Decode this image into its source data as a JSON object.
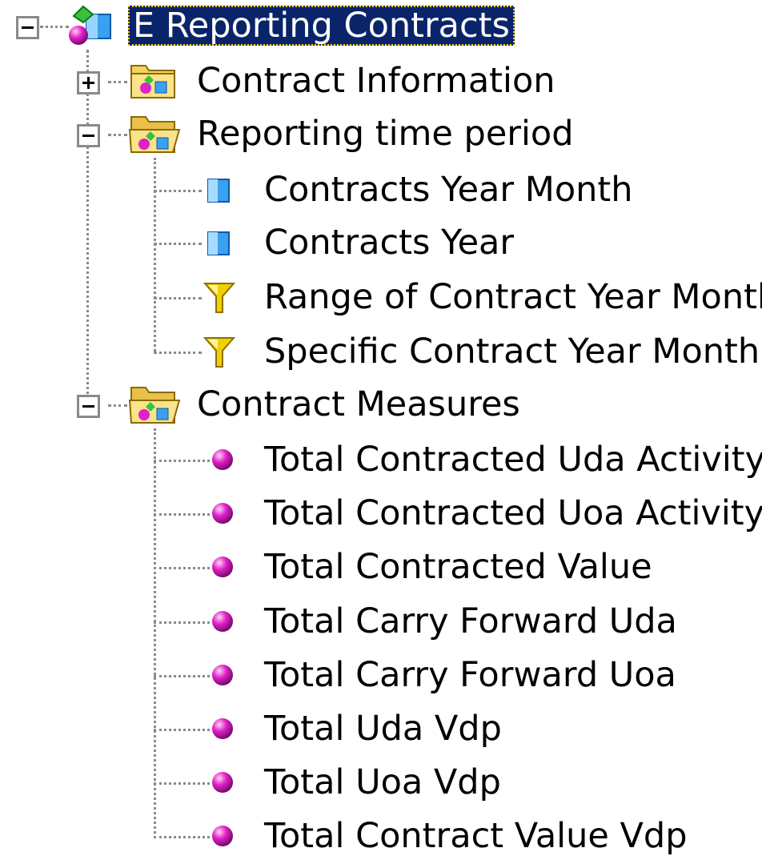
{
  "tree": {
    "root": {
      "label": "E Reporting Contracts",
      "expanded": true,
      "selected": true,
      "icon": "universe-icon"
    },
    "folders": [
      {
        "label": "Contract Information",
        "expanded": false,
        "icon": "class-folder-closed-icon",
        "children": []
      },
      {
        "label": "Reporting time period",
        "expanded": true,
        "icon": "class-folder-open-icon",
        "children": [
          {
            "label": "Contracts Year Month",
            "icon": "dimension-cube-icon"
          },
          {
            "label": "Contracts Year",
            "icon": "dimension-cube-icon"
          },
          {
            "label": "Range of Contract Year Month",
            "icon": "filter-funnel-icon"
          },
          {
            "label": "Specific Contract Year Month",
            "icon": "filter-funnel-icon"
          }
        ]
      },
      {
        "label": "Contract Measures",
        "expanded": true,
        "icon": "class-folder-open-icon",
        "children": [
          {
            "label": "Total Contracted Uda Activity",
            "icon": "measure-sphere-icon"
          },
          {
            "label": "Total Contracted Uoa Activity",
            "icon": "measure-sphere-icon"
          },
          {
            "label": "Total Contracted Value",
            "icon": "measure-sphere-icon"
          },
          {
            "label": "Total Carry Forward Uda",
            "icon": "measure-sphere-icon"
          },
          {
            "label": "Total Carry Forward Uoa",
            "icon": "measure-sphere-icon"
          },
          {
            "label": "Total Uda Vdp",
            "icon": "measure-sphere-icon"
          },
          {
            "label": "Total Uoa Vdp",
            "icon": "measure-sphere-icon"
          },
          {
            "label": "Total Contract Value Vdp",
            "icon": "measure-sphere-icon"
          }
        ]
      }
    ],
    "colors": {
      "selection_bg": "#0a246a",
      "selection_text": "#ffffff",
      "measure_magenta": "#e020c8",
      "dimension_blue": "#3aa0f0",
      "filter_yellow": "#f0d000",
      "folder_yellow": "#f4d25c"
    }
  }
}
